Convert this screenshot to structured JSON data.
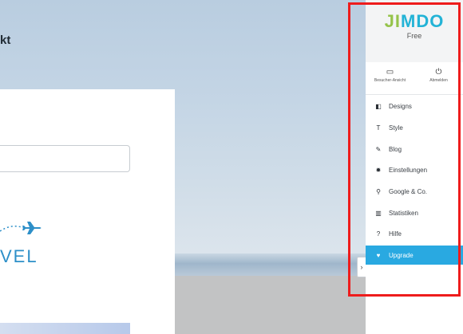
{
  "page": {
    "heading": "kt",
    "logo_text": "VEL"
  },
  "sidebar": {
    "brand": {
      "j": "JI",
      "rest": "MDO"
    },
    "plan": "Free",
    "quick": [
      {
        "icon": "monitor-icon",
        "glyph": "▭",
        "label": "Besucher-Ansicht"
      },
      {
        "icon": "power-icon",
        "glyph": "⏻",
        "label": "Abmelden"
      }
    ],
    "items": [
      {
        "label": "Designs",
        "glyph": "◧"
      },
      {
        "label": "Style",
        "glyph": "T"
      },
      {
        "label": "Blog",
        "glyph": "✎"
      },
      {
        "label": "Einstellungen",
        "glyph": "✹"
      },
      {
        "label": "Google & Co.",
        "glyph": "⚲"
      },
      {
        "label": "Statistiken",
        "glyph": "▥"
      },
      {
        "label": "Hilfe",
        "glyph": "?"
      },
      {
        "label": "Upgrade",
        "glyph": "♥"
      }
    ],
    "active_index": 7,
    "collapse_glyph": "›"
  },
  "colors": {
    "accent": "#29a9e1",
    "highlight": "#ee1c1c",
    "brand_blue": "#23b3d6",
    "brand_green": "#95c34a"
  }
}
